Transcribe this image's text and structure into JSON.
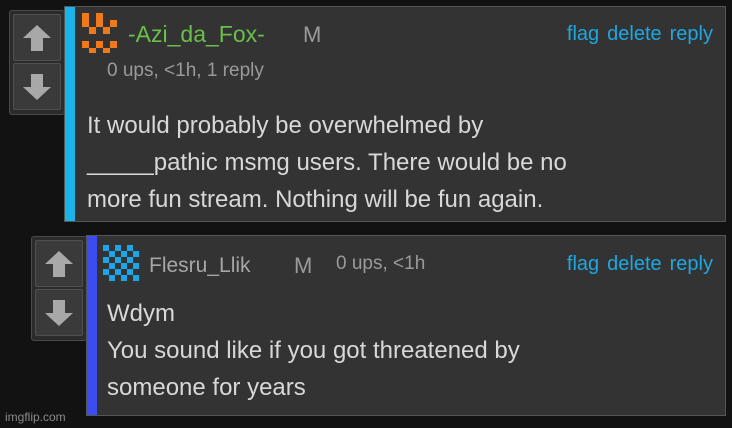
{
  "comments": [
    {
      "username": "-Azi_da_Fox-",
      "badge": "M",
      "meta": "0 ups, <1h, 1 reply",
      "actions": [
        "flag",
        "delete",
        "reply"
      ],
      "text": "It would probably be overwhelmed by\n_____pathic msmg users. There would be no\nmore fun stream. Nothing will be fun again.",
      "accent_color": "#1ab4e8",
      "username_color": "#6abf4b",
      "avatar_color": "#f07a1a"
    },
    {
      "username": "Flesru_Llik",
      "badge": "M",
      "meta": "0 ups, <1h",
      "actions": [
        "flag",
        "delete",
        "reply"
      ],
      "text": "Wdym\nYou sound like if you got threatened by\nsomeone for years",
      "accent_color": "#3b4cf0",
      "username_color": "#a6a6a6",
      "avatar_color": "#1aa6e8"
    }
  ],
  "watermark": "imgflip.com"
}
